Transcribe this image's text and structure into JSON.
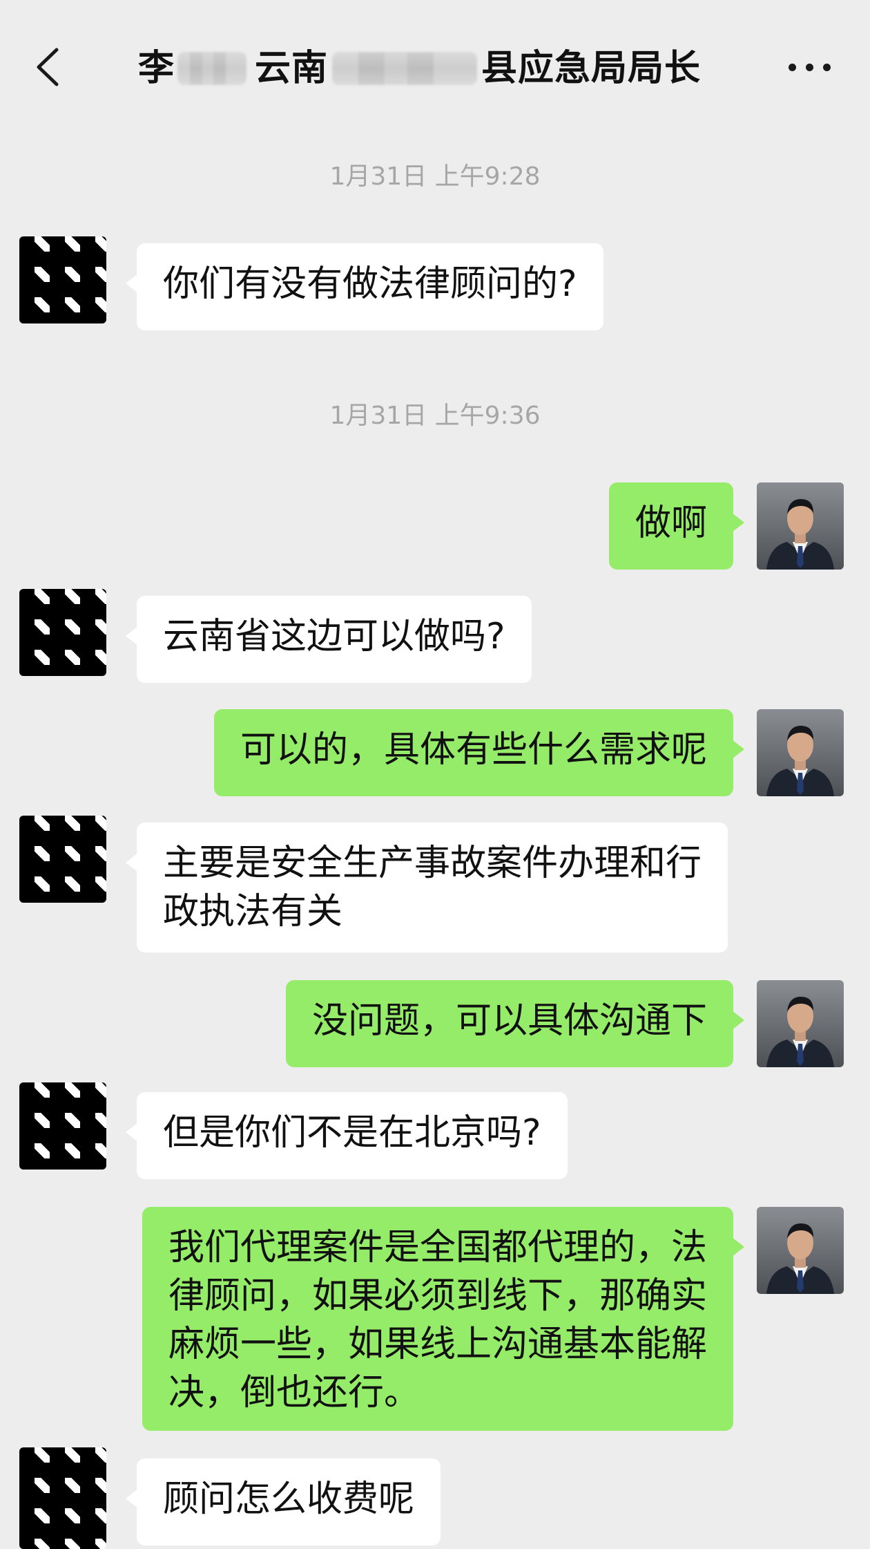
{
  "header": {
    "title_parts": [
      "李",
      "云南",
      "县应急局局长"
    ]
  },
  "messages": {
    "t1": "1月31日 上午9:28",
    "m1": "你们有没有做法律顾问的?",
    "t2": "1月31日 上午9:36",
    "m2": "做啊",
    "m3": "云南省这边可以做吗?",
    "m4": "可以的，具体有些什么需求呢",
    "m5": "主要是安全生产事故案件办理和行\n政执法有关",
    "m6": "没问题，可以具体沟通下",
    "m7": "但是你们不是在北京吗?",
    "m8": "我们代理案件是全国都代理的，法\n律顾问，如果必须到线下，那确实\n麻烦一些，如果线上沟通基本能解\n决，倒也还行。",
    "m9": "顾问怎么收费呢"
  },
  "colors": {
    "background": "#ededed",
    "incoming_bubble": "#ffffff",
    "outgoing_bubble": "#95ec69",
    "timestamp": "#a6a6a6"
  },
  "icons": {
    "back": "chevron-left-icon",
    "more": "more-dots-icon"
  }
}
